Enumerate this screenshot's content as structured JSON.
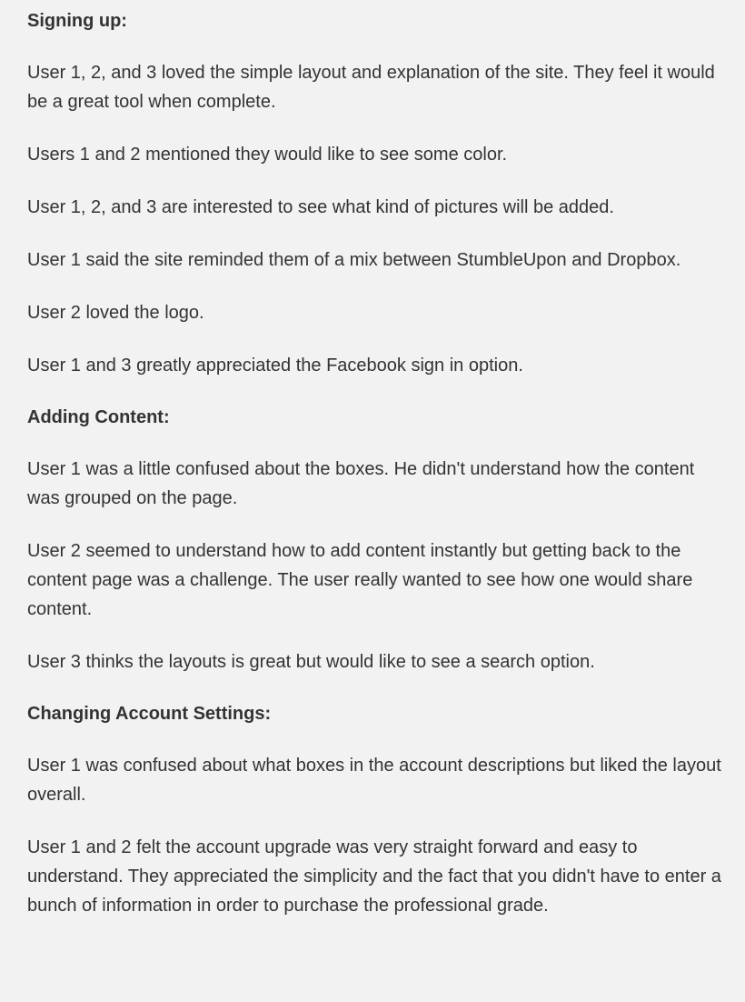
{
  "sections": [
    {
      "heading": "Signing up:",
      "paragraphs": [
        "User 1, 2, and 3 loved the simple layout and explanation of the site. They feel it would be a great tool when complete.",
        "Users 1 and 2 mentioned they would like to see some color.",
        "User 1, 2, and 3 are interested to see what kind of pictures will be added.",
        "User 1 said the site reminded them of a mix between StumbleUpon and Dropbox.",
        "User 2 loved the logo.",
        "User 1 and 3 greatly appreciated the Facebook sign in option."
      ]
    },
    {
      "heading": "Adding Content:",
      "paragraphs": [
        "User 1 was a little confused about the boxes. He didn't understand how the content was grouped on the page.",
        "User 2 seemed to understand how to add content instantly but getting back to the content page was a challenge. The user really wanted to see how one would share content.",
        "User 3 thinks the layouts is great but would like to see a search option."
      ]
    },
    {
      "heading": "Changing Account Settings:",
      "paragraphs": [
        "User 1 was confused about what boxes in the account descriptions but liked the layout overall.",
        "User 1 and 2 felt the account upgrade was very straight forward and easy to understand. They appreciated the simplicity and the fact that you didn't have to enter a bunch of information in order to purchase the professional grade."
      ]
    }
  ]
}
